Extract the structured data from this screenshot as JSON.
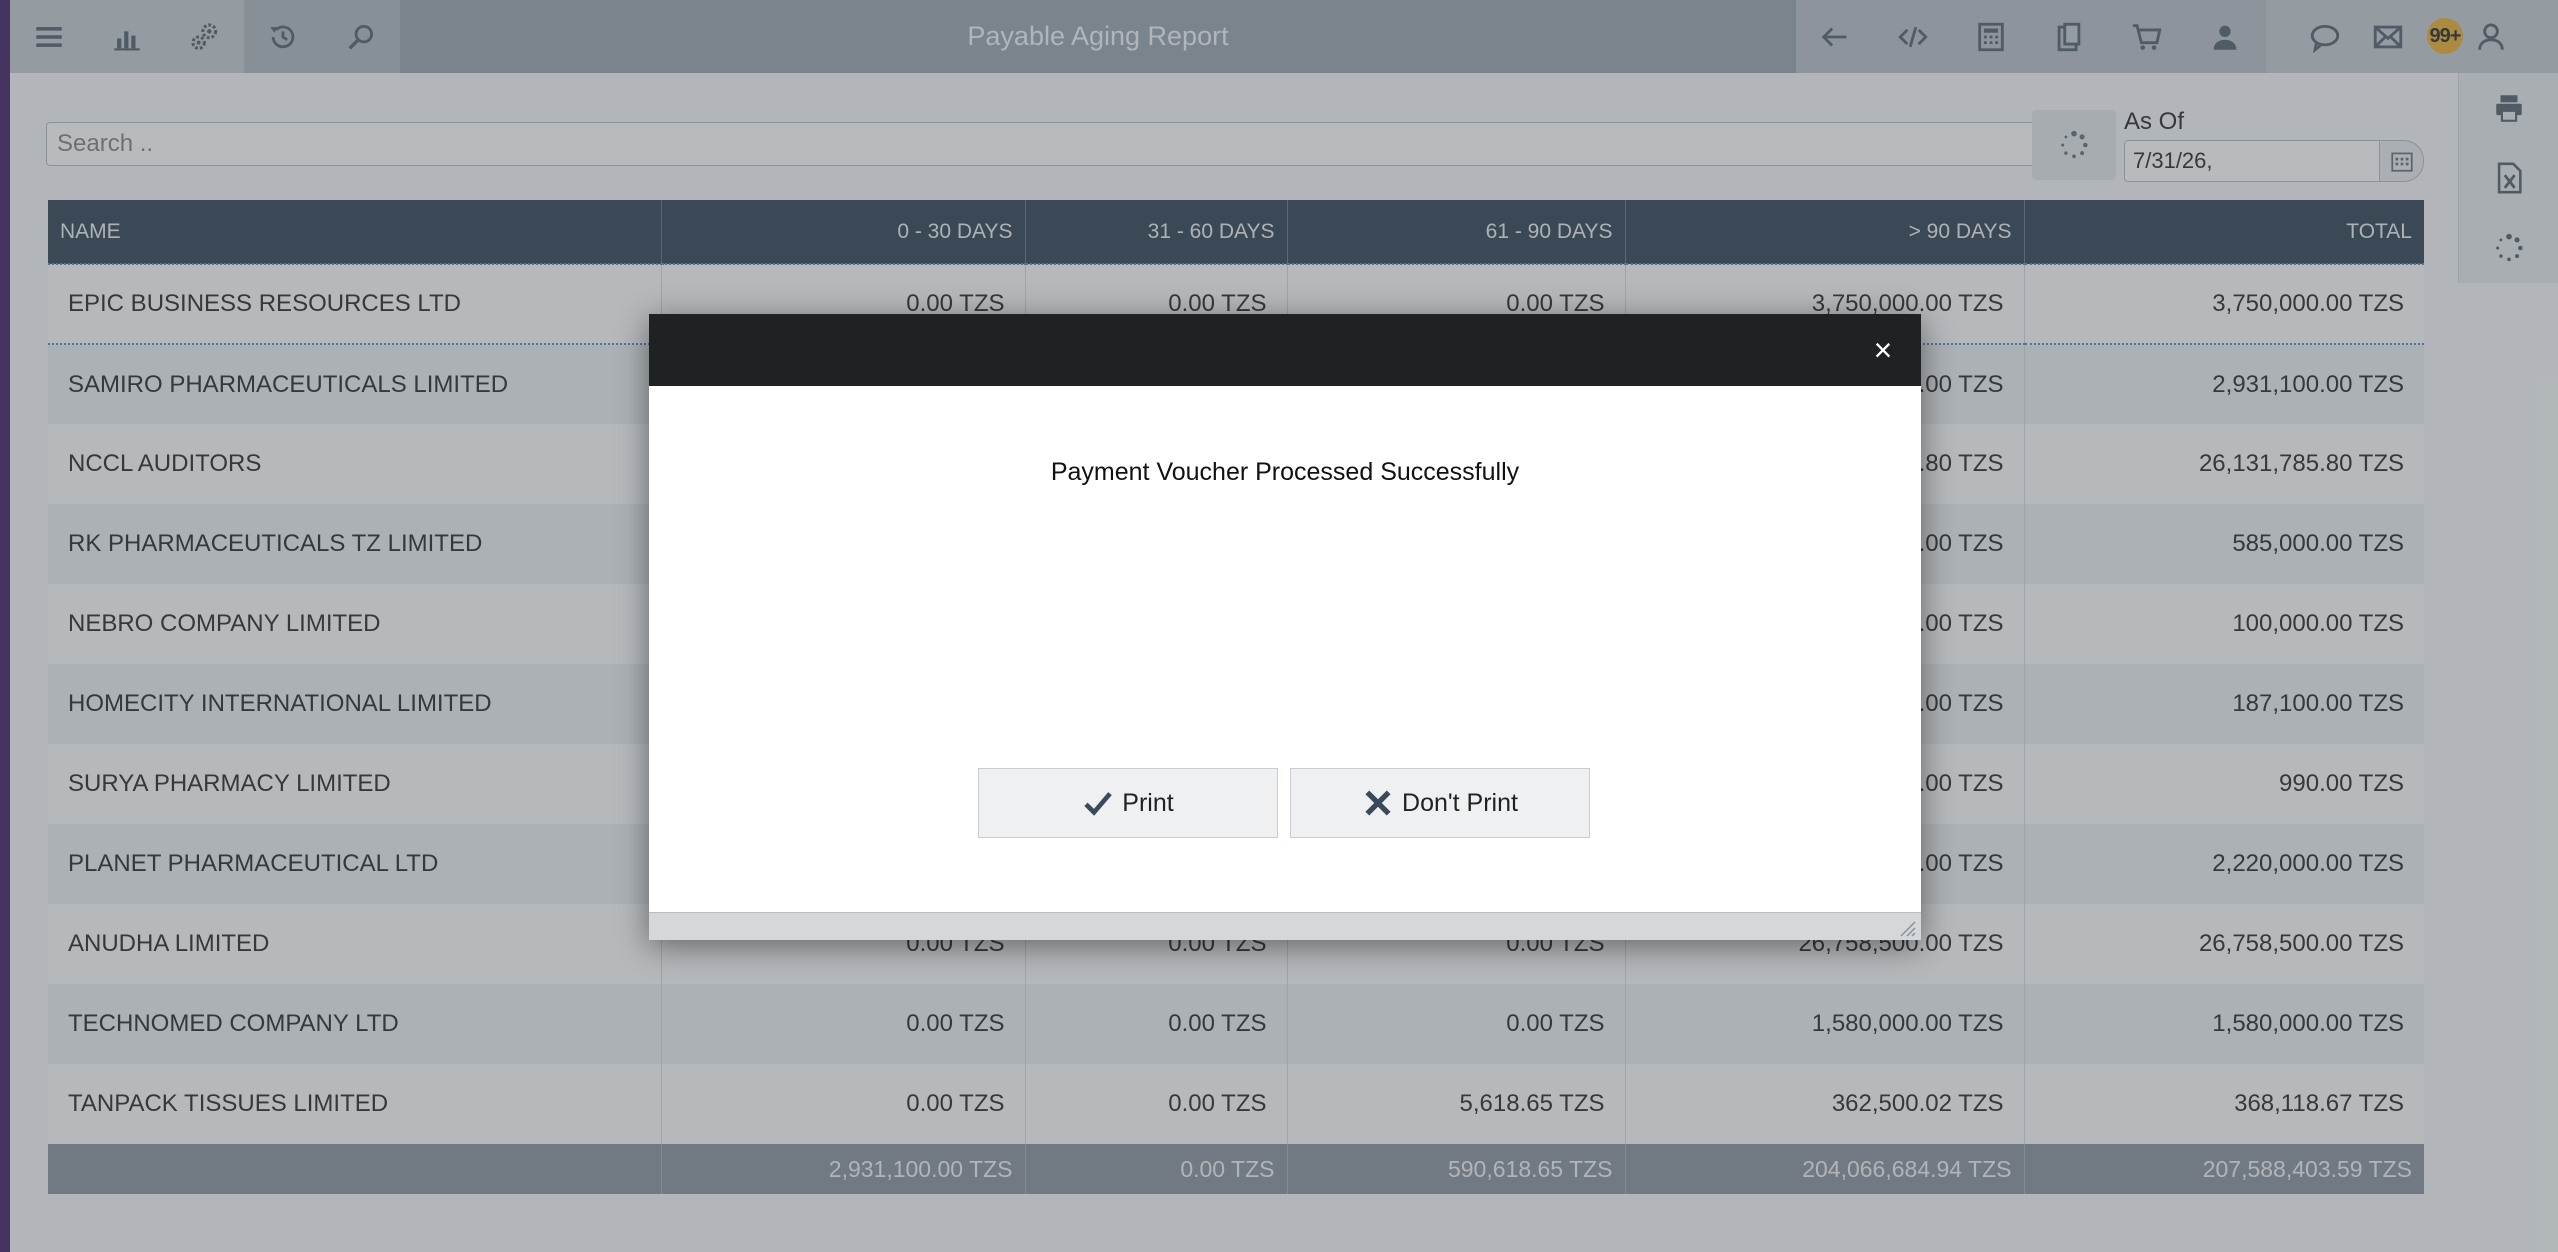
{
  "toolbar": {
    "title": "Payable Aging Report",
    "left_icons": [
      "menu-icon",
      "bar-chart-icon",
      "gears-icon",
      "history-icon",
      "search-icon"
    ],
    "right_icons": [
      "back-arrow-icon",
      "code-icon",
      "calculator-icon",
      "clipboard-icon",
      "cart-icon",
      "users-icon",
      "chat-icon",
      "mail-icon",
      "user-icon"
    ],
    "notification_badge": "99+"
  },
  "side_panel": {
    "icons": [
      "printer-icon",
      "excel-icon",
      "spinner-icon"
    ]
  },
  "search": {
    "placeholder": "Search .."
  },
  "as_of": {
    "label": "As Of",
    "value": "7/31/26,"
  },
  "table": {
    "columns": [
      "NAME",
      "0 - 30 DAYS",
      "31 - 60 DAYS",
      "61 - 90 DAYS",
      "> 90 DAYS",
      "TOTAL"
    ],
    "rows": [
      [
        "EPIC BUSINESS RESOURCES LTD",
        "0.00 TZS",
        "0.00 TZS",
        "0.00 TZS",
        "3,750,000.00 TZS",
        "3,750,000.00 TZS"
      ],
      [
        "SAMIRO PHARMACEUTICALS LIMITED",
        "",
        "",
        "",
        ".00 TZS",
        "2,931,100.00 TZS"
      ],
      [
        "NCCL AUDITORS",
        "",
        "",
        "",
        ".80 TZS",
        "26,131,785.80 TZS"
      ],
      [
        "RK PHARMACEUTICALS TZ LIMITED",
        "",
        "",
        "",
        ".00 TZS",
        "585,000.00 TZS"
      ],
      [
        "NEBRO COMPANY LIMITED",
        "",
        "",
        "",
        ".00 TZS",
        "100,000.00 TZS"
      ],
      [
        "HOMECITY INTERNATIONAL LIMITED",
        "",
        "",
        "",
        ".00 TZS",
        "187,100.00 TZS"
      ],
      [
        "SURYA PHARMACY LIMITED",
        "",
        "",
        "",
        ".00 TZS",
        "990.00 TZS"
      ],
      [
        "PLANET PHARMACEUTICAL LTD",
        "",
        "",
        "",
        ".00 TZS",
        "2,220,000.00 TZS"
      ],
      [
        "ANUDHA LIMITED",
        "0.00 TZS",
        "0.00 TZS",
        "0.00 TZS",
        "26,758,500.00 TZS",
        "26,758,500.00 TZS"
      ],
      [
        "TECHNOMED COMPANY LTD",
        "0.00 TZS",
        "0.00 TZS",
        "0.00 TZS",
        "1,580,000.00 TZS",
        "1,580,000.00 TZS"
      ],
      [
        "TANPACK TISSUES LIMITED",
        "0.00 TZS",
        "0.00 TZS",
        "5,618.65 TZS",
        "362,500.02 TZS",
        "368,118.67 TZS"
      ]
    ],
    "totals": [
      "",
      "2,931,100.00 TZS",
      "0.00 TZS",
      "590,618.65 TZS",
      "204,066,684.94 TZS",
      "207,588,403.59 TZS"
    ]
  },
  "dialog": {
    "close_label": "×",
    "message": "Payment Voucher Processed Successfully",
    "print_label": "Print",
    "dont_print_label": "Don't Print"
  },
  "colors": {
    "header": "#3b4a5a",
    "toolbar": "#c3c9ce",
    "dialog_titlebar": "#1f2225",
    "badge": "#e8b13a"
  }
}
